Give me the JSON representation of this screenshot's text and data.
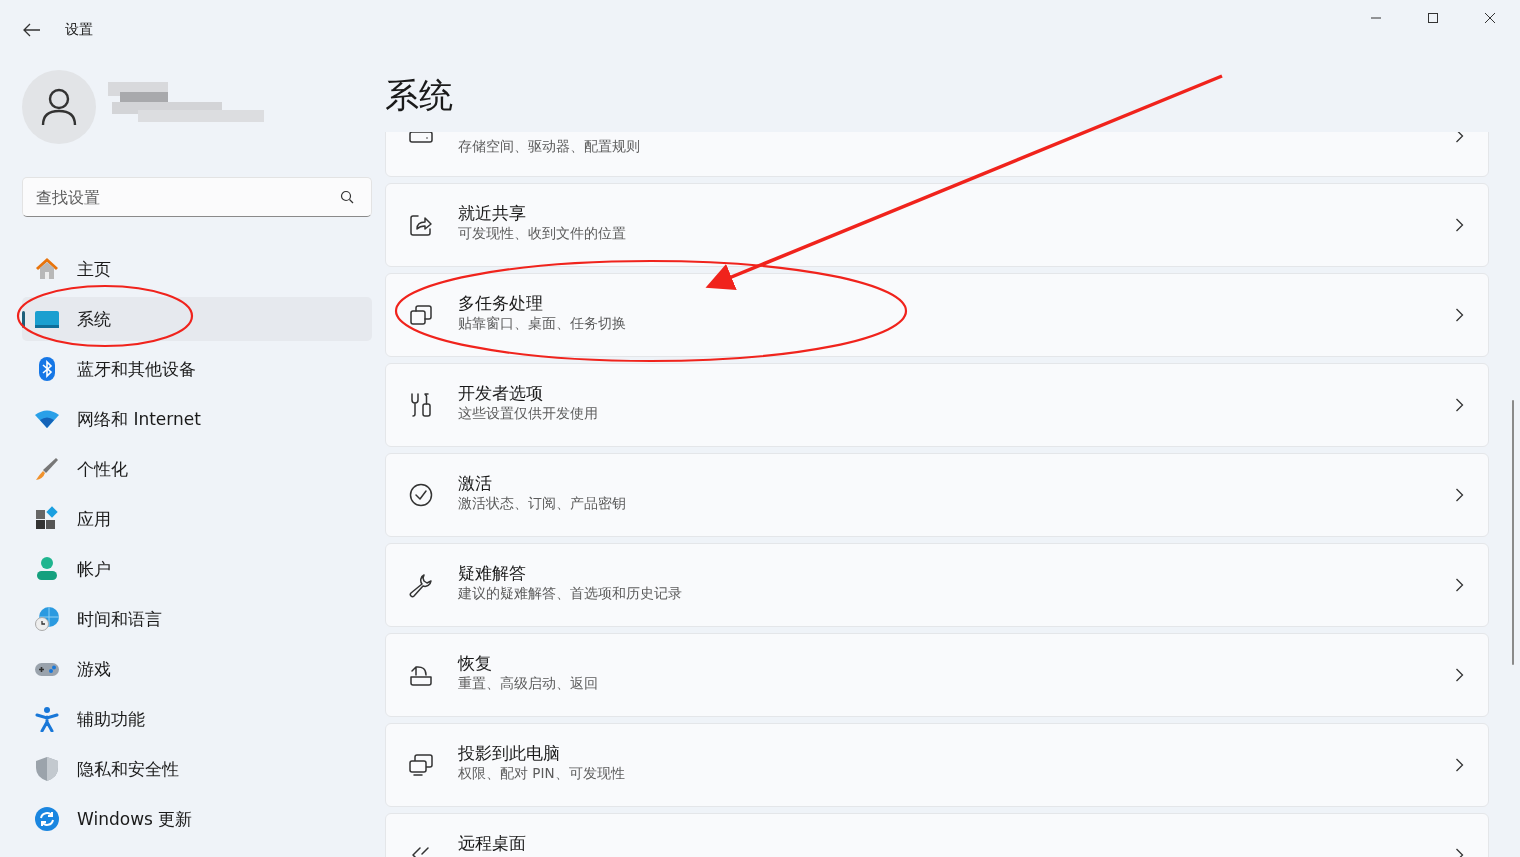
{
  "window": {
    "title": "设置"
  },
  "search": {
    "placeholder": "查找设置"
  },
  "nav": [
    {
      "label": "主页",
      "selected": false
    },
    {
      "label": "系统",
      "selected": true
    },
    {
      "label": "蓝牙和其他设备",
      "selected": false
    },
    {
      "label": "网络和 Internet",
      "selected": false
    },
    {
      "label": "个性化",
      "selected": false
    },
    {
      "label": "应用",
      "selected": false
    },
    {
      "label": "帐户",
      "selected": false
    },
    {
      "label": "时间和语言",
      "selected": false
    },
    {
      "label": "游戏",
      "selected": false
    },
    {
      "label": "辅助功能",
      "selected": false
    },
    {
      "label": "隐私和安全性",
      "selected": false
    },
    {
      "label": "Windows 更新",
      "selected": false
    }
  ],
  "page": {
    "title": "系统"
  },
  "cards": [
    {
      "subtitle": "存储空间、驱动器、配置规则"
    },
    {
      "title": "就近共享",
      "subtitle": "可发现性、收到文件的位置"
    },
    {
      "title": "多任务处理",
      "subtitle": "贴靠窗口、桌面、任务切换"
    },
    {
      "title": "开发者选项",
      "subtitle": "这些设置仅供开发使用"
    },
    {
      "title": "激活",
      "subtitle": "激活状态、订阅、产品密钥"
    },
    {
      "title": "疑难解答",
      "subtitle": "建议的疑难解答、首选项和历史记录"
    },
    {
      "title": "恢复",
      "subtitle": "重置、高级启动、返回"
    },
    {
      "title": "投影到此电脑",
      "subtitle": "权限、配对 PIN、可发现性"
    },
    {
      "title": "远程桌面"
    }
  ],
  "annotations": [
    {
      "kind": "ellipse"
    },
    {
      "kind": "ellipse"
    },
    {
      "kind": "arrow"
    }
  ]
}
